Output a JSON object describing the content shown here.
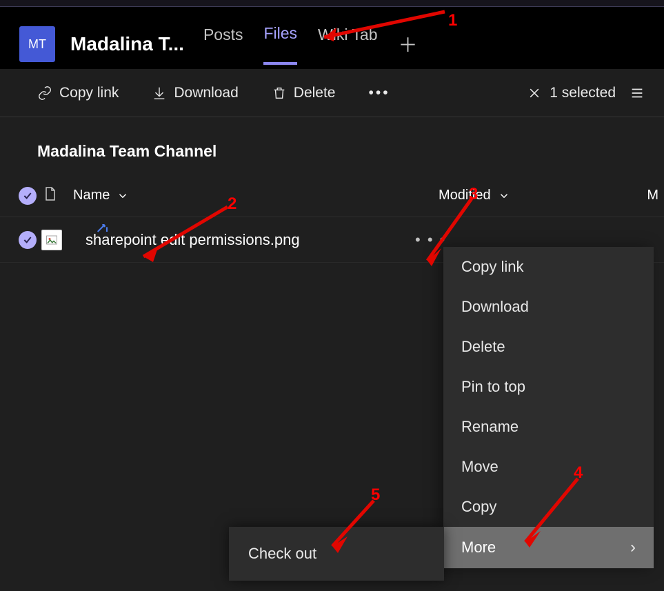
{
  "header": {
    "avatar_initials": "MT",
    "team_name": "Madalina T...",
    "tabs": {
      "posts": "Posts",
      "files": "Files",
      "wiki": "Wiki Tab"
    }
  },
  "toolbar": {
    "copy_link": "Copy link",
    "download": "Download",
    "delete": "Delete",
    "selected": "1 selected"
  },
  "channel_title": "Madalina Team Channel",
  "columns": {
    "name": "Name",
    "modified": "Modified",
    "right_cut": "M"
  },
  "file": {
    "name": "sharepoint edit permissions.png"
  },
  "context_menu": {
    "copy_link": "Copy link",
    "download": "Download",
    "delete": "Delete",
    "pin": "Pin to top",
    "rename": "Rename",
    "move": "Move",
    "copy": "Copy",
    "more": "More"
  },
  "submenu": {
    "check_out": "Check out"
  },
  "annotations": {
    "a1": "1",
    "a2": "2",
    "a3": "3",
    "a4": "4",
    "a5": "5"
  }
}
